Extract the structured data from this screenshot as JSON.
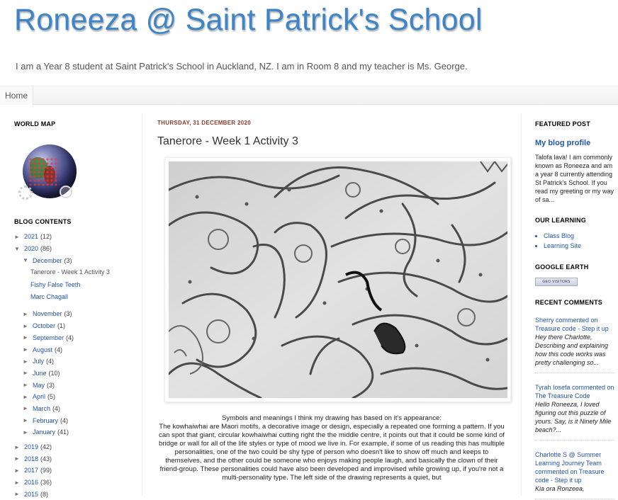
{
  "header": {
    "title": "Roneeza @ Saint Patrick's School",
    "description": "I am a Year 8 student at Saint Patrick's School in Auckland, NZ. I am in Room 8 and my teacher is Ms. George."
  },
  "tabs": [
    {
      "label": "Home"
    }
  ],
  "left_sidebar": {
    "map_title": "WORLD MAP",
    "archive_title": "BLOG CONTENTS",
    "archive": {
      "y2021": {
        "label": "2021",
        "count": "(12)"
      },
      "y2020": {
        "label": "2020",
        "count": "(86)"
      },
      "december": {
        "label": "December",
        "count": "(3)"
      },
      "posts": [
        "Tanerore - Week 1 Activity 3",
        "Fishy False Teeth",
        "Marc Chagall"
      ],
      "months": [
        {
          "label": "November",
          "count": "(3)"
        },
        {
          "label": "October",
          "count": "(1)"
        },
        {
          "label": "September",
          "count": "(4)"
        },
        {
          "label": "August",
          "count": "(4)"
        },
        {
          "label": "July",
          "count": "(4)"
        },
        {
          "label": "June",
          "count": "(10)"
        },
        {
          "label": "May",
          "count": "(3)"
        },
        {
          "label": "April",
          "count": "(5)"
        },
        {
          "label": "March",
          "count": "(4)"
        },
        {
          "label": "February",
          "count": "(4)"
        },
        {
          "label": "January",
          "count": "(41)"
        }
      ],
      "years": [
        {
          "label": "2019",
          "count": "(42)"
        },
        {
          "label": "2018",
          "count": "(43)"
        },
        {
          "label": "2017",
          "count": "(99)"
        },
        {
          "label": "2016",
          "count": "(36)"
        },
        {
          "label": "2015",
          "count": "(8)"
        }
      ],
      "expanded_glyph": "▼",
      "collapsed_glyph": "►"
    }
  },
  "post": {
    "date": "THURSDAY, 31 DECEMBER 2020",
    "title": "Tanerore - Week 1 Activity 3",
    "image_icon": "kowhaiwhai-drawing-image",
    "body_lead": "Symbols and meanings I think my drawing has based on it's appearance:",
    "body": "The kowhaiwhai are Maori motifs, a decorative image or design, especially a repeated one forming a pattern. If you can spot that giant, circular kowhaiwhai cutting right the the middle centre, it points out that it could be some kind of bridge or wall for all of the life styles or type of mood we live in. For example, if some of us reading this has multiple personalities, one of the two could be shy type of person who doesn't like to show off much and keeps to themselves, and the other could be someone who enjoys making people laugh, and basically the clown of their friend-group. These personalities could have also been developed and improvised while growing up, if you're not a multi-personality type. The left side of the drawing represents a quiet, but"
  },
  "right_sidebar": {
    "featured_title": "FEATURED POST",
    "featured_link": "My blog profile",
    "featured_text": "Talofa lava! I am commonly known as Roneeza and am a year 8 currently attending St Patrick's School. If you read my greeting or my way of sa...",
    "learning_title": "OUR LEARNING",
    "learning_links": [
      "Class Blog",
      "Learning Site"
    ],
    "earth_title": "GOOGLE EARTH",
    "earth_badge": "GEO VISITORS",
    "comments_title": "RECENT COMMENTS",
    "comments": [
      {
        "who": "Sherry commented on Treasure code - Step it up",
        "text": "Hey there Charlotte, Describing and explaining how this code works was pretty challenging so..."
      },
      {
        "who": "Tyrah Iosefa commented on The Treasure Code",
        "text": "Hello Roneeza, I loved figuring out this puzzle of yours. Say, is it Ninety Mile beach?..."
      },
      {
        "who": "Charlotte S @ Summer Learning Journey Team commented on Treasure code - Step it up",
        "text": "Kia ora Ronzeea,"
      }
    ]
  },
  "colors": {
    "title_blue": "#3d85c6",
    "link_blue": "#2255aa",
    "date_color": "#8a3c2a"
  }
}
